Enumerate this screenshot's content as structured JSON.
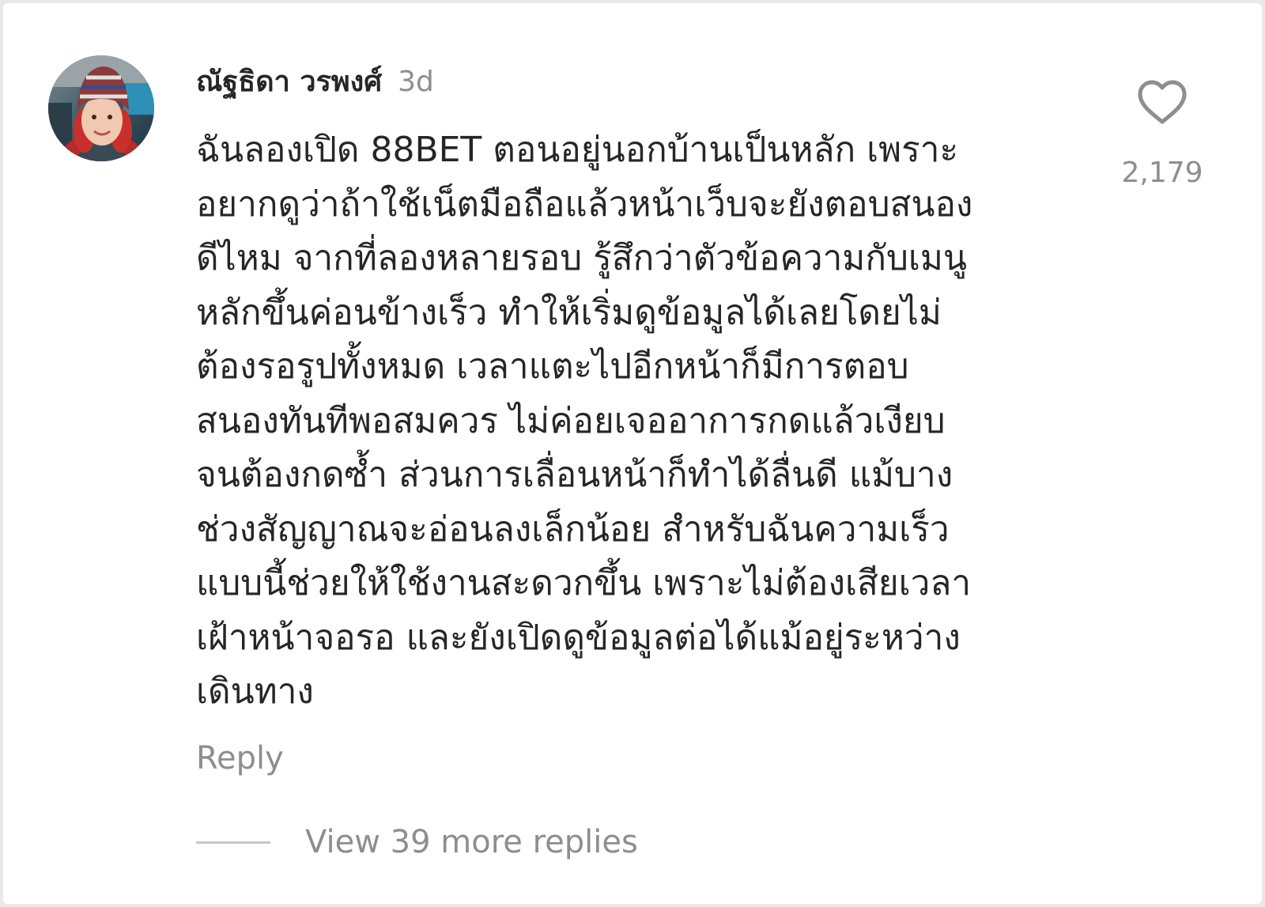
{
  "comment": {
    "author": "ณัฐธิดา วรพงศ์",
    "time": "3d",
    "avatar_icon": "user-avatar-photo",
    "lines": [
      "ฉันลองเปิด 88BET ตอนอยู่นอกบ้านเป็นหลัก เพราะ",
      "อยากดูว่าถ้าใช้เน็ตมือถือแล้วหน้าเว็บจะยังตอบสนอง",
      "ดีไหม จากที่ลองหลายรอบ รู้สึกว่าตัวข้อความกับเมนู",
      "หลักขึ้นค่อนข้างเร็ว ทำให้เริ่มดูข้อมูลได้เลยโดยไม่",
      "ต้องรอรูปทั้งหมด เวลาแตะไปอีกหน้าก็มีการตอบ",
      "สนองทันทีพอสมควร ไม่ค่อยเจออาการกดแล้วเงียบ",
      "จนต้องกดซ้ำ ส่วนการเลื่อนหน้าก็ทำได้ลื่นดี แม้บาง",
      "ช่วงสัญญาณจะอ่อนลงเล็กน้อย สำหรับฉันความเร็ว",
      "แบบนี้ช่วยให้ใช้งานสะดวกขึ้น เพราะไม่ต้องเสียเวลา",
      "เฝ้าหน้าจอรอ และยังเปิดดูข้อมูลต่อได้แม้อยู่ระหว่าง",
      "เดินทาง"
    ],
    "reply_label": "Reply",
    "view_more_label": "View 39 more replies",
    "like_icon": "heart-outline-icon",
    "like_count": "2,179"
  },
  "colors": {
    "text_primary": "#262626",
    "text_secondary": "#8e8e8e",
    "background": "#ffffff"
  }
}
